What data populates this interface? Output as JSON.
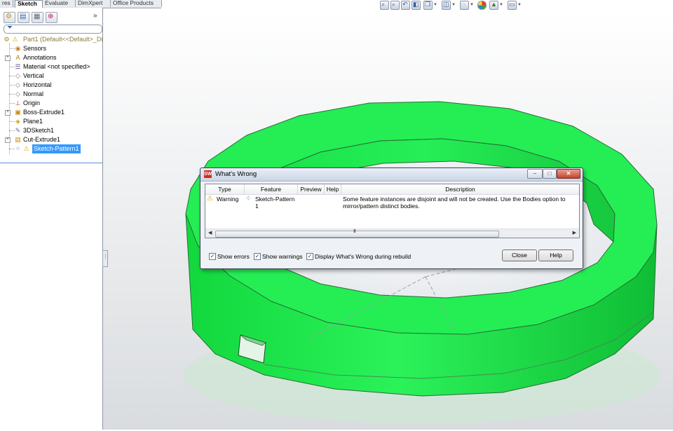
{
  "top_tabs": [
    "res",
    "Sketch",
    "Evaluate",
    "DimXpert",
    "Office Products"
  ],
  "view_toolbar": {
    "icons": [
      "zoom-to-fit-icon",
      "zoom-to-area-icon",
      "previous-view-icon",
      "section-view-icon",
      "view-orientation-icon",
      "display-style-icon",
      "hide-show-items-icon",
      "edit-appearance-icon",
      "apply-scene-icon",
      "view-settings-icon"
    ]
  },
  "feature_tree": {
    "items": [
      {
        "label": "Part1  (Default<<Default>_Di",
        "icon": "part-icon",
        "warning": true
      },
      {
        "label": "Sensors",
        "icon": "sensors-icon"
      },
      {
        "label": "Annotations",
        "icon": "annotations-icon",
        "expandable": true
      },
      {
        "label": "Material <not specified>",
        "icon": "material-icon"
      },
      {
        "label": "Vertical",
        "icon": "plane-icon"
      },
      {
        "label": "Horizontal",
        "icon": "plane-icon"
      },
      {
        "label": "Normal",
        "icon": "plane-icon"
      },
      {
        "label": "Origin",
        "icon": "origin-icon"
      },
      {
        "label": "Boss-Extrude1",
        "icon": "extrude-icon",
        "expandable": true
      },
      {
        "label": "Plane1",
        "icon": "plane-icon"
      },
      {
        "label": "3DSketch1",
        "icon": "3dsketch-icon"
      },
      {
        "label": "Cut-Extrude1",
        "icon": "cut-extrude-icon",
        "expandable": true
      },
      {
        "label": "Sketch-Pattern1",
        "icon": "sketch-pattern-icon",
        "warning": true,
        "selected": true
      }
    ]
  },
  "dialog": {
    "title": "What's Wrong",
    "window_controls": {
      "minimize": "–",
      "maximize": "□",
      "close": "✕"
    },
    "columns": [
      "Type",
      "Feature",
      "Preview",
      "Help",
      "Description"
    ],
    "rows": [
      {
        "type": "Warning",
        "feature": "Sketch-Pattern 1",
        "description": "Some feature instances are disjoint and will not be created. Use the Bodies option to mirror/pattern distinct bodies."
      }
    ],
    "scroll_grip": "III",
    "checkboxes": [
      {
        "label": "Show errors",
        "checked": true
      },
      {
        "label": "Show warnings",
        "checked": true
      },
      {
        "label": "Display What's Wrong during rebuild",
        "checked": true
      }
    ],
    "buttons": {
      "close": "Close",
      "help": "Help"
    }
  },
  "colors": {
    "part_green": "#1ef050",
    "part_green_dark": "#12c03a",
    "selection_highlight": "#3399ff",
    "dialog_bg": "#eef1f5"
  }
}
